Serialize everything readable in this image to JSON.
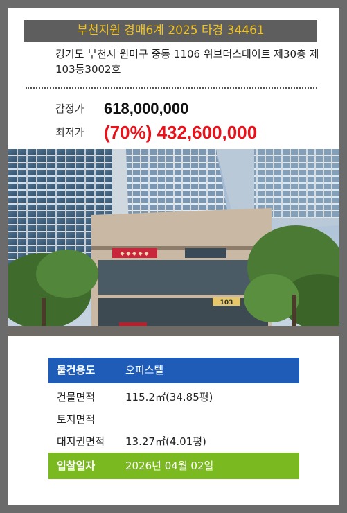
{
  "header": {
    "case_title": "부천지원 경매6계 2025 타경 34461"
  },
  "property": {
    "address": "경기도 부천시 원미구 중동 1106 위브더스테이트 제30층 제103동3002호"
  },
  "prices": {
    "appraisal_label": "감정가",
    "appraisal_value": "618,000,000",
    "minimum_label": "최저가",
    "minimum_value": "(70%) 432,600,000"
  },
  "photo": {
    "sign_text": "103"
  },
  "details": {
    "use_label": "물건용도",
    "use_value": "오피스텔",
    "building_area_label": "건물면적",
    "building_area_value": "115.2㎡(34.85평)",
    "land_area_label": "토지면적",
    "land_area_value": "",
    "land_right_label": "대지권면적",
    "land_right_value": "13.27㎡(4.01평)",
    "bid_date_label": "입찰일자",
    "bid_date_value": "2026년 04월 02일"
  },
  "colors": {
    "header_bg": "#5e5e5e",
    "header_text": "#f3c31b",
    "min_price": "#e8121b",
    "use_row_bg": "#1f5cb8",
    "bid_row_bg": "#7ab91f",
    "frame_bg": "#6b6b6b"
  }
}
